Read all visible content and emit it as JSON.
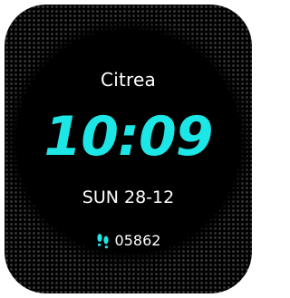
{
  "watchface": {
    "brand": "Citrea",
    "time": "10:09",
    "date": "SUN 28-12",
    "steps": {
      "icon": "footsteps-icon",
      "value": "05862"
    }
  },
  "colors": {
    "accent": "#1de6e6",
    "text": "#ffffff",
    "background": "#000000",
    "dot_pattern": "#3a3a3a"
  }
}
